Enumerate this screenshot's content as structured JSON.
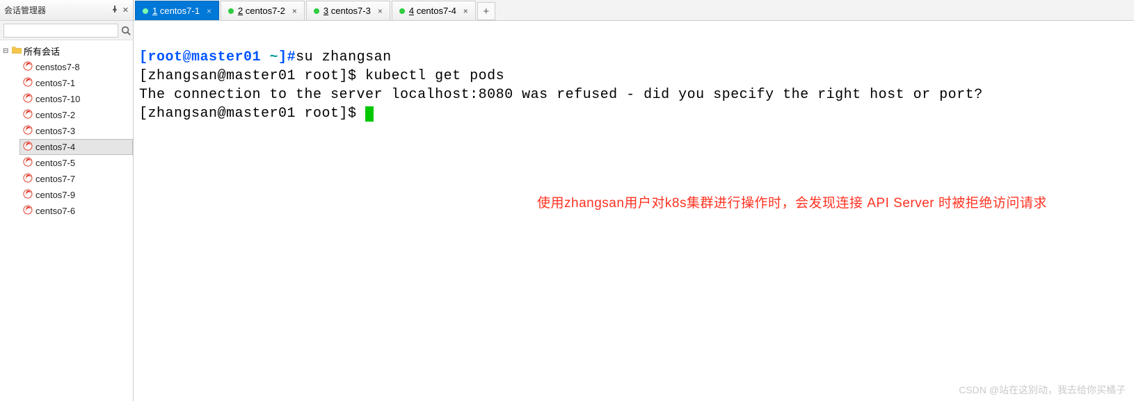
{
  "sidebar": {
    "title": "会话管理器",
    "root_label": "所有会话",
    "items": [
      {
        "label": "censtos7-8"
      },
      {
        "label": "centos7-1"
      },
      {
        "label": "centos7-10"
      },
      {
        "label": "centos7-2"
      },
      {
        "label": "centos7-3"
      },
      {
        "label": "centos7-4"
      },
      {
        "label": "centos7-5"
      },
      {
        "label": "centos7-7"
      },
      {
        "label": "centos7-9"
      },
      {
        "label": "centso7-6"
      }
    ],
    "selected_index": 5
  },
  "tabs": {
    "items": [
      {
        "num": "1",
        "label": "centos7-1",
        "active": true
      },
      {
        "num": "2",
        "label": "centos7-2",
        "active": false
      },
      {
        "num": "3",
        "label": "centos7-3",
        "active": false
      },
      {
        "num": "4",
        "label": "centos7-4",
        "active": false
      }
    ],
    "add_label": "+"
  },
  "terminal": {
    "line1": {
      "bracket_open": "[",
      "user": "root@master01 ",
      "tilde": "~",
      "bracket_close": "]",
      "hash": "#",
      "cmd": "su zhangsan"
    },
    "line2": "[zhangsan@master01 root]$ kubectl get pods",
    "line3": "The connection to the server localhost:8080 was refused - did you specify the right host or port?",
    "line4": "[zhangsan@master01 root]$ "
  },
  "annotation": "使用zhangsan用户对k8s集群进行操作时，会发现连接 API Server 时被拒绝访问请求",
  "watermark": "CSDN @站在这别动，我去给你买橘子"
}
